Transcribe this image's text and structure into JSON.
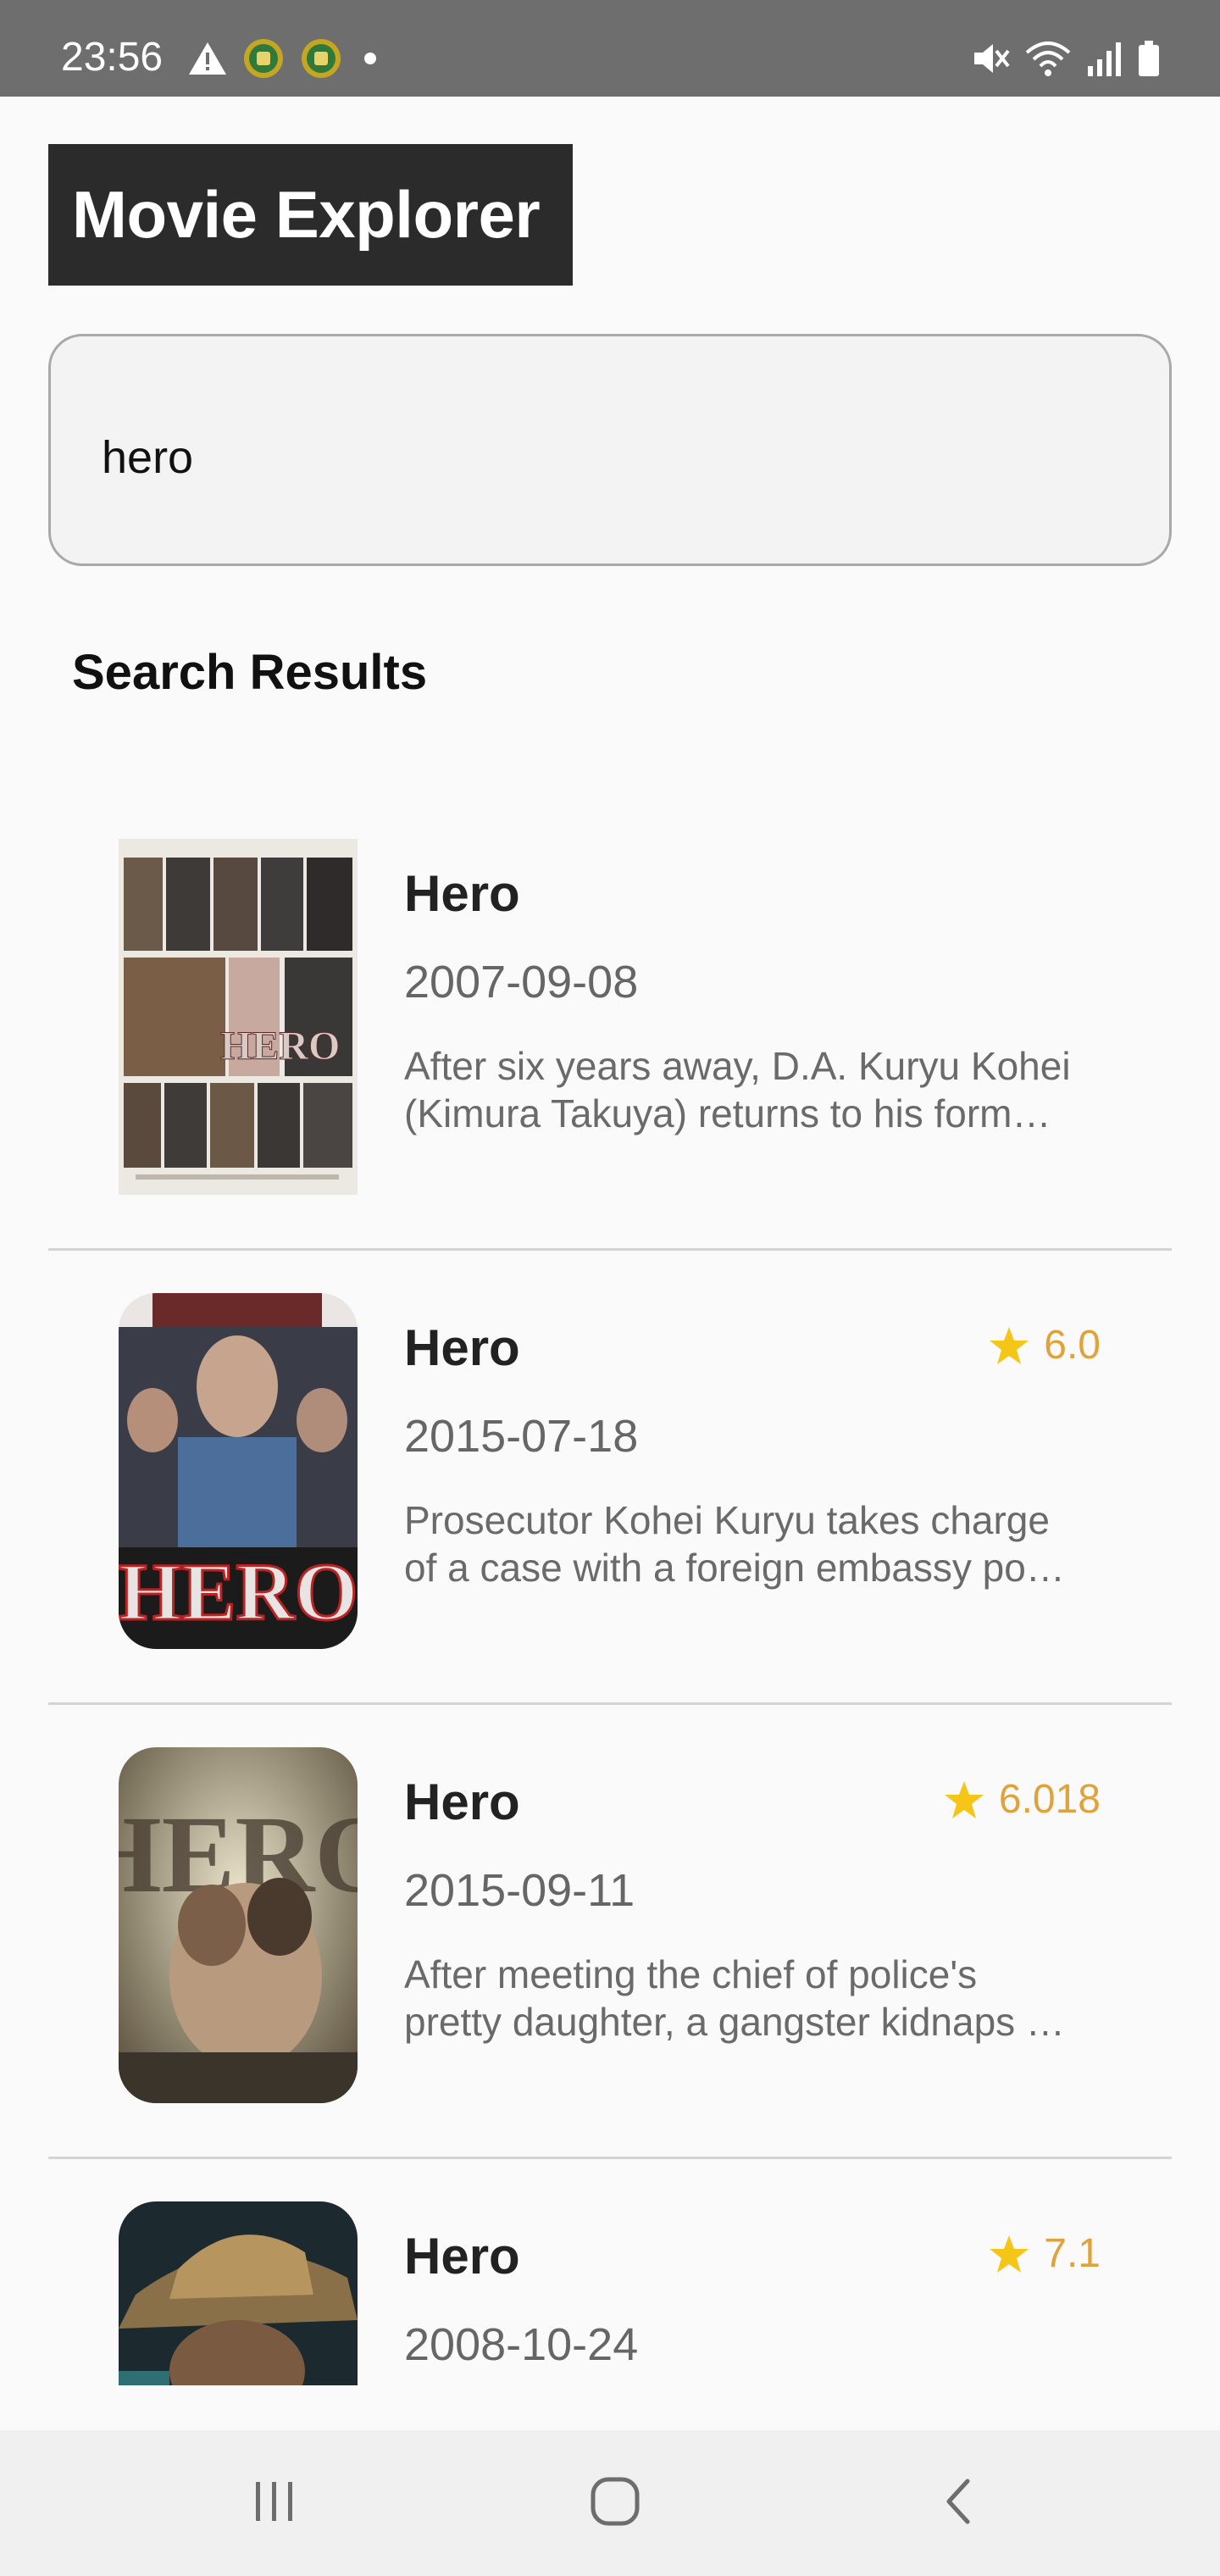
{
  "status_bar": {
    "time": "23:56",
    "left_icons": [
      "warning-icon",
      "app-notification-icon",
      "app-notification-icon",
      "dot-icon"
    ],
    "right_icons": [
      "mute-icon",
      "wifi-icon",
      "signal-icon",
      "battery-icon"
    ]
  },
  "app": {
    "title": "Movie Explorer"
  },
  "search": {
    "value": "hero"
  },
  "results": {
    "heading": "Search Results",
    "items": [
      {
        "title": "Hero",
        "date": "2007-09-08",
        "rating": "",
        "overview": "After six years away, D.A. Kuryu Kohei\n(Kimura Takuya) returns to his form…"
      },
      {
        "title": "Hero",
        "date": "2015-07-18",
        "rating": "6.0",
        "overview": "Prosecutor Kohei Kuryu takes charge\nof a case with a foreign embassy po…"
      },
      {
        "title": "Hero",
        "date": "2015-09-11",
        "rating": "6.018",
        "overview": "After meeting the chief of police's\npretty daughter, a gangster kidnaps …"
      },
      {
        "title": "Hero",
        "date": "2008-10-24",
        "rating": "7.1",
        "overview": ""
      }
    ]
  },
  "colors": {
    "rating": "#e0a23a",
    "star": "#f5c518",
    "title_bg": "#2b2b2b",
    "status_bar": "#6e6e6e"
  },
  "nav_bar": {
    "icons": [
      "recent-apps-icon",
      "home-icon",
      "back-icon"
    ]
  }
}
